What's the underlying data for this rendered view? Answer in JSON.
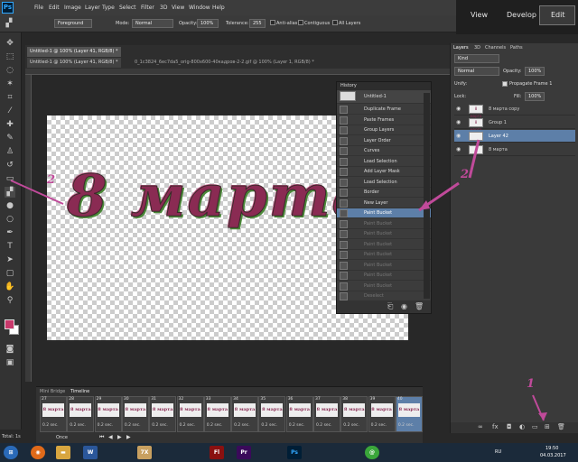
{
  "app": {
    "logo": "Ps"
  },
  "menu": [
    "File",
    "Edit",
    "Image",
    "Layer",
    "Type",
    "Select",
    "Filter",
    "3D",
    "View",
    "Window",
    "Help"
  ],
  "workspace": [
    "View",
    "Develop",
    "Edit"
  ],
  "options": {
    "source_value": "Foreground",
    "mode_label": "Mode:",
    "mode_value": "Normal",
    "opacity_label": "Opacity:",
    "opacity_value": "100%",
    "tolerance_label": "Tolerance:",
    "tolerance_value": "255",
    "anti_alias": "Anti-alias",
    "contiguous": "Contiguous",
    "all_layers": "All Layers"
  },
  "doc_tabs": [
    "Untitled-1 @ 100% (Layer 41, RGB/8) *",
    "Untitled-1 @ 100% (Layer 41, RGB/8) *",
    "Untitled-1 @ 100% (Layer 41, RGB/8) *"
  ],
  "doc_tab_inactive": "0_1c3824_6ec7da5_orig-800x600-40кадров-2-2.gif @ 100% (Layer 1, RGB/8) *",
  "canvas_text": "8 марта",
  "history": {
    "title": "History",
    "snapshot": "Untitled-1",
    "items": [
      {
        "label": "Duplicate Frame",
        "state": "normal"
      },
      {
        "label": "Paste Frames",
        "state": "normal"
      },
      {
        "label": "Group Layers",
        "state": "normal"
      },
      {
        "label": "Layer Order",
        "state": "normal"
      },
      {
        "label": "Curves",
        "state": "normal"
      },
      {
        "label": "Load Selection",
        "state": "normal"
      },
      {
        "label": "Add Layer Mask",
        "state": "normal"
      },
      {
        "label": "Load Selection",
        "state": "normal"
      },
      {
        "label": "Border",
        "state": "normal"
      },
      {
        "label": "New Layer",
        "state": "normal"
      },
      {
        "label": "Paint Bucket",
        "state": "active"
      },
      {
        "label": "Paint Bucket",
        "state": "dim"
      },
      {
        "label": "Paint Bucket",
        "state": "dim"
      },
      {
        "label": "Paint Bucket",
        "state": "dim"
      },
      {
        "label": "Paint Bucket",
        "state": "dim"
      },
      {
        "label": "Paint Bucket",
        "state": "dim"
      },
      {
        "label": "Paint Bucket",
        "state": "dim"
      },
      {
        "label": "Paint Bucket",
        "state": "dim"
      },
      {
        "label": "Deselect",
        "state": "dim"
      }
    ]
  },
  "timeline": {
    "tabs": [
      "Mini Bridge",
      "Timeline"
    ],
    "loop": "Once",
    "frames": [
      {
        "n": "27",
        "d": "0.2 sec."
      },
      {
        "n": "28",
        "d": "0.2 sec."
      },
      {
        "n": "29",
        "d": "0.2 sec."
      },
      {
        "n": "30",
        "d": "0.2 sec."
      },
      {
        "n": "31",
        "d": "0.2 sec."
      },
      {
        "n": "32",
        "d": "0.2 sec."
      },
      {
        "n": "33",
        "d": "0.2 sec."
      },
      {
        "n": "34",
        "d": "0.2 sec."
      },
      {
        "n": "35",
        "d": "0.2 sec."
      },
      {
        "n": "36",
        "d": "0.2 sec."
      },
      {
        "n": "37",
        "d": "0.2 sec."
      },
      {
        "n": "38",
        "d": "0.2 sec."
      },
      {
        "n": "39",
        "d": "0.2 sec."
      },
      {
        "n": "40",
        "d": "0.2 sec."
      }
    ],
    "frame_label": "8 марта"
  },
  "layers_panel": {
    "tabs": [
      "Layers",
      "3D",
      "Channels",
      "Paths"
    ],
    "kind": "Kind",
    "blend": "Normal",
    "opacity_label": "Opacity:",
    "opacity_value": "100%",
    "unify_label": "Unify:",
    "propagate": "Propagate Frame 1",
    "lock_label": "Lock:",
    "fill_label": "Fill:",
    "fill_value": "100%",
    "layers": [
      {
        "name": "8 марта copy",
        "selected": false,
        "thumb": "8 марта"
      },
      {
        "name": "Group 1",
        "selected": false,
        "thumb": "8 марта"
      },
      {
        "name": "Layer 42",
        "selected": true,
        "thumb": ""
      },
      {
        "name": "8 марта",
        "selected": false,
        "thumb": ""
      }
    ]
  },
  "annotations": {
    "one": "1",
    "two": "2"
  },
  "status_left": "Total: 1s",
  "clock": {
    "time": "19:50",
    "date": "04.03.2017"
  },
  "lang": "RU",
  "taskbar_apps": [
    "W",
    "Fl",
    "Pr",
    "Ps",
    "7X"
  ]
}
